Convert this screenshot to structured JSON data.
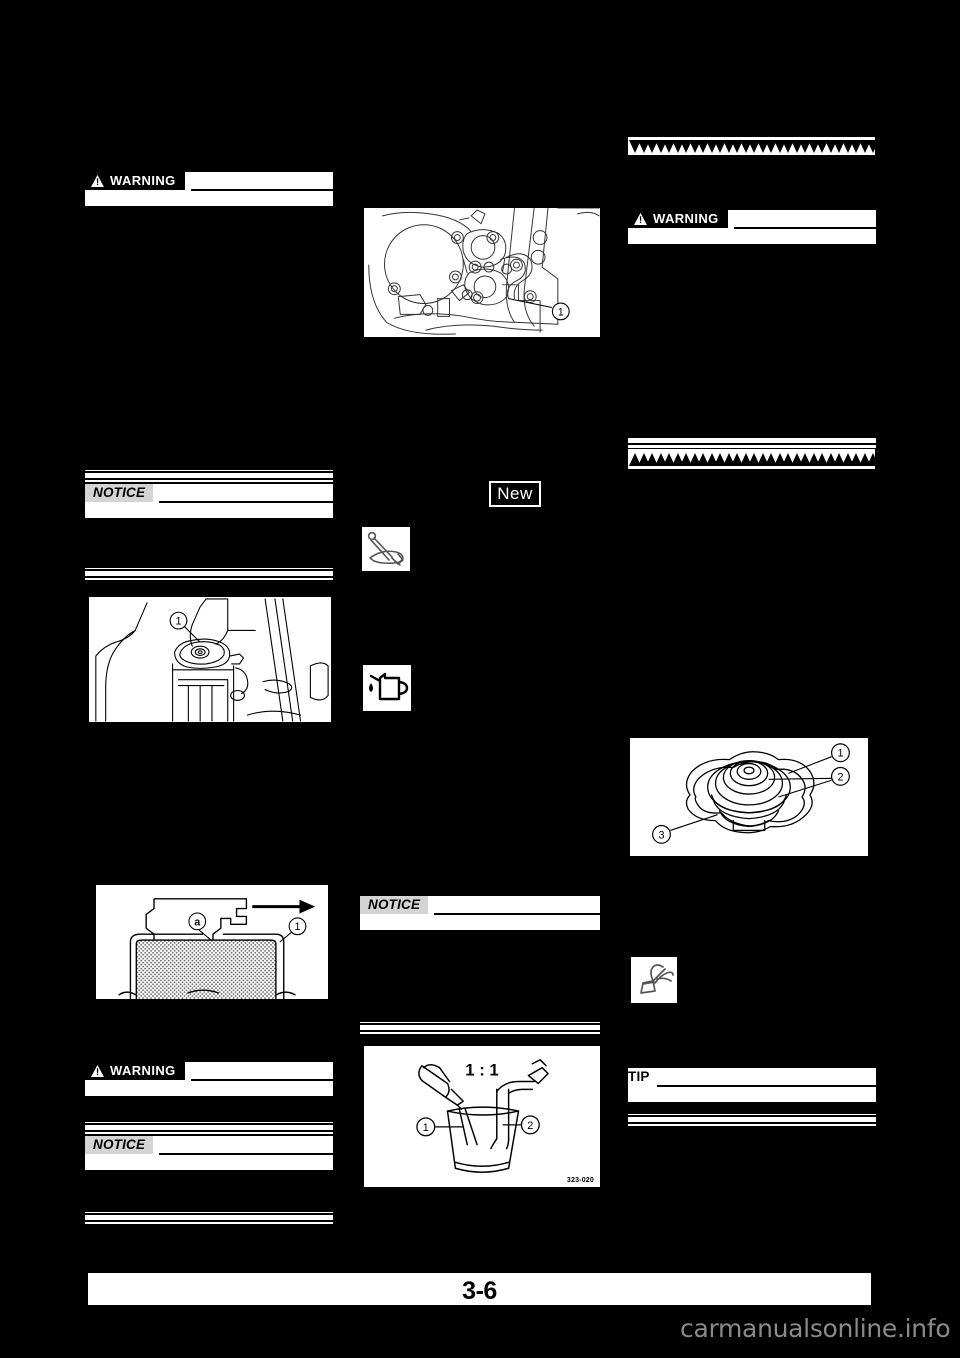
{
  "document": {
    "kind": "service-manual-page",
    "page_number": "3-6",
    "watermark": "carmanualsonline.info"
  },
  "labels": {
    "warning": "WARNING",
    "notice": "NOTICE",
    "tip": "TIP",
    "new_tag": "New"
  },
  "left_column": {
    "warning_1": {
      "label": "WARNING"
    },
    "notice_1": {
      "label": "NOTICE"
    },
    "figure_radiator_cap_removal": {
      "name": "radiator-cap-removal",
      "callouts": [
        "1"
      ]
    },
    "figure_seal_cross_section": {
      "name": "radiator-cap-seal-cross-section",
      "callouts": [
        "1"
      ],
      "detail_callouts": [
        "a"
      ]
    },
    "warning_2": {
      "label": "WARNING"
    },
    "notice_2": {
      "label": "NOTICE"
    }
  },
  "middle_column": {
    "figure_engine_coolant_drain_bolt": {
      "name": "engine-coolant-drain-bolt",
      "callouts": [
        "1"
      ]
    },
    "new_tag": "New",
    "icon_torque_wrench": "torque-wrench-icon",
    "icon_oil_can": "oil-can-icon",
    "notice_1": {
      "label": "NOTICE"
    },
    "figure_coolant_mixing": {
      "name": "coolant-mixing-ratio",
      "ratio": "1 : 1",
      "callouts": [
        "1",
        "2"
      ],
      "figure_id": "323-020"
    }
  },
  "right_column": {
    "triangle_band_down": {
      "name": "section-end-triangles-down",
      "count": 29
    },
    "warning_1": {
      "label": "WARNING"
    },
    "triangle_band_up": {
      "name": "section-start-triangles-up",
      "count": 29
    },
    "figure_radiator_cap_parts": {
      "name": "radiator-cap-parts",
      "callouts": [
        "1",
        "2",
        "3"
      ]
    },
    "icon_special_tool": "special-tool-icon",
    "tip_1": {
      "label": "TIP"
    }
  },
  "colors": {
    "page_background": "#000000",
    "text_band": "#ffffff",
    "notice_chip": "#d4d4d4",
    "warning_chip": "#000000",
    "watermark": "#8a8a8a"
  }
}
